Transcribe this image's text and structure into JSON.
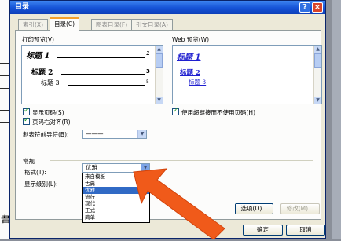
{
  "dialog": {
    "title": "目录",
    "help_label": "?",
    "close_label": "×"
  },
  "tabs": [
    "索引(X)",
    "目录(C)",
    "图表目录(F)",
    "引文目录(A)"
  ],
  "print_preview": {
    "label": "打印预览(V)",
    "entries": [
      {
        "text": "标题 1",
        "page": "1"
      },
      {
        "text": "标题 2",
        "page": "3"
      },
      {
        "text": "标题 3",
        "page": "5"
      }
    ]
  },
  "web_preview": {
    "label": "Web 预览(W)",
    "links": [
      "标题 1",
      "标题 2",
      "标题 3"
    ]
  },
  "options": {
    "show_page_numbers": "显示页码(S)",
    "right_align": "页码右对齐(R)",
    "tab_leader_label": "制表符前导符(B):",
    "tab_leader_value": "———",
    "use_hyperlinks": "使用超链接而不使用页码(H)"
  },
  "general": {
    "group_label": "常规",
    "format_label": "格式(T):",
    "format_value": "优雅",
    "levels_label": "显示级别(L):",
    "format_options": [
      "来自模板",
      "古典",
      "优雅",
      "流行",
      "现代",
      "正式",
      "简单"
    ],
    "selected_index": 2
  },
  "buttons": {
    "options": "选项(O)...",
    "modify": "修改(M)...",
    "ok": "确定",
    "cancel": "取消"
  },
  "background_doc": {
    "char": "吾"
  },
  "colors": {
    "titlebar": "#1552d6",
    "selection": "#316ac5",
    "arrow": "#f05a1a"
  }
}
